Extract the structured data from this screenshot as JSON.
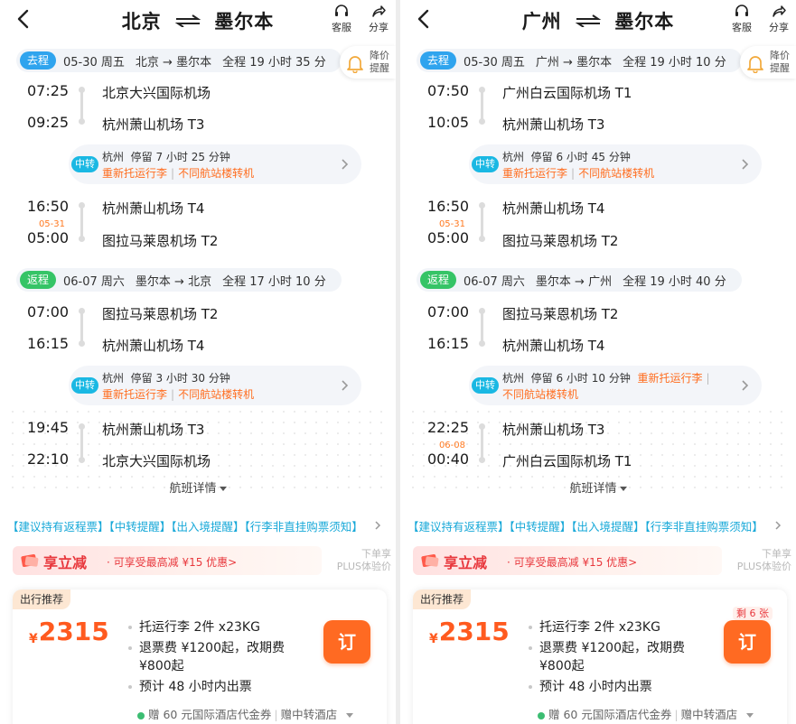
{
  "colors": {
    "go_tag": "#2fa4ee",
    "return_tag": "#35c466",
    "transfer_badge": "#1ab8e3",
    "accent_orange": "#ff6d1f",
    "price": "#ff5a1f",
    "promo_red": "#e8383d",
    "notice_blue": "#17a8d8"
  },
  "icons": {
    "back": "chevron-left-icon",
    "swap": "swap-arrows-icon",
    "service": "headset-icon",
    "share": "share-icon",
    "bell": "bell-icon",
    "promo": "coupon-icon"
  },
  "header": {
    "service_label": "客服",
    "share_label": "分享"
  },
  "price_alert": {
    "label_line1": "降价",
    "label_line2": "提醒"
  },
  "detail_label": "航班详情",
  "notice": "【建议持有返程票】【中转提醒】【出入境提醒】【行李非直挂购票须知】",
  "promo": {
    "title": "享立减",
    "subtitle": "· 可享受最高减 ¥15 优惠>"
  },
  "plus": {
    "line1": "下单享",
    "line2": "PLUS体验价"
  },
  "card": {
    "tag": "出行推荐",
    "currency": "¥",
    "book_label": "订",
    "feature_baggage": "托运行李 2件 x23KG",
    "feature_refund": "退票费 ¥1200起，改期费 ¥800起",
    "feature_issue": "预计 48 小时内出票",
    "gift": "赠 60 元国际酒店代金券",
    "gift_extra": "赠中转酒店"
  },
  "left": {
    "from": "北京",
    "to": "墨尔本",
    "outbound": {
      "tag": "去程",
      "date": "05-30 周五",
      "route": "北京 → 墨尔本",
      "duration": "全程 19 小时 35 分",
      "dep_time": "07:25",
      "dep_airport": "北京大兴国际机场",
      "mid_arr_time": "09:25",
      "mid_arr_airport": "杭州萧山机场 T3",
      "transfer_city": "杭州",
      "transfer_stay": "停留 7 小时 25 分钟",
      "transfer_note1": "重新托运行李",
      "transfer_note2": "不同航站楼转机",
      "mid_dep_time": "16:50",
      "mid_dep_airport": "杭州萧山机场 T4",
      "arr_date": "05-31",
      "arr_time": "05:00",
      "arr_airport": "图拉马莱恩机场 T2"
    },
    "return": {
      "tag": "返程",
      "date": "06-07 周六",
      "route": "墨尔本 → 北京",
      "duration": "全程 17 小时 10 分",
      "dep_time": "07:00",
      "dep_airport": "图拉马莱恩机场 T2",
      "mid_arr_time": "16:15",
      "mid_arr_airport": "杭州萧山机场 T4",
      "transfer_city": "杭州",
      "transfer_stay": "停留 3 小时 30 分钟",
      "transfer_note1": "重新托运行李",
      "transfer_note2": "不同航站楼转机",
      "mid_dep_time": "19:45",
      "mid_dep_airport": "杭州萧山机场 T3",
      "arr_time": "22:10",
      "arr_airport": "北京大兴国际机场"
    },
    "price": "2315"
  },
  "right": {
    "from": "广州",
    "to": "墨尔本",
    "outbound": {
      "tag": "去程",
      "date": "05-30 周五",
      "route": "广州 → 墨尔本",
      "duration": "全程 19 小时 10 分",
      "dep_time": "07:50",
      "dep_airport": "广州白云国际机场 T1",
      "mid_arr_time": "10:05",
      "mid_arr_airport": "杭州萧山机场 T3",
      "transfer_city": "杭州",
      "transfer_stay": "停留 6 小时 45 分钟",
      "transfer_note1": "重新托运行李",
      "transfer_note2": "不同航站楼转机",
      "mid_dep_time": "16:50",
      "mid_dep_airport": "杭州萧山机场 T4",
      "arr_date": "05-31",
      "arr_time": "05:00",
      "arr_airport": "图拉马莱恩机场 T2"
    },
    "return": {
      "tag": "返程",
      "date": "06-07 周六",
      "route": "墨尔本 → 广州",
      "duration": "全程 19 小时 40 分",
      "dep_time": "07:00",
      "dep_airport": "图拉马莱恩机场 T2",
      "mid_arr_time": "16:15",
      "mid_arr_airport": "杭州萧山机场 T4",
      "transfer_city": "杭州",
      "transfer_stay": "停留 6 小时 10 分钟",
      "transfer_note1": "重新托运行李",
      "transfer_note2": "不同航站楼转机",
      "mid_dep_time": "22:25",
      "mid_dep_airport": "杭州萧山机场 T3",
      "arr_date": "06-08",
      "arr_time": "00:40",
      "arr_airport": "广州白云国际机场 T1"
    },
    "price": "2315",
    "remaining": "剩 6 张"
  }
}
